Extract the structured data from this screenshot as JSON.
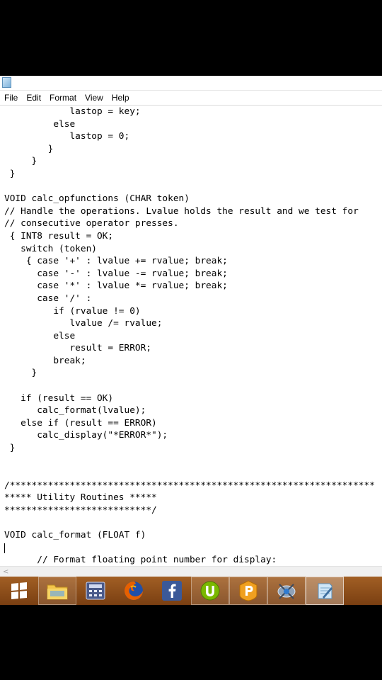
{
  "menubar": {
    "items": [
      "File",
      "Edit",
      "Format",
      "View",
      "Help"
    ]
  },
  "editor": {
    "lines": [
      "            lastop = key;",
      "         else",
      "            lastop = 0;",
      "        }",
      "     }",
      " }",
      "",
      "VOID calc_opfunctions (CHAR token)",
      "// Handle the operations. Lvalue holds the result and we test for",
      "// consecutive operator presses.",
      " { INT8 result = OK;",
      "   switch (token)",
      "    { case '+' : lvalue += rvalue; break;",
      "      case '-' : lvalue -= rvalue; break;",
      "      case '*' : lvalue *= rvalue; break;",
      "      case '/' :",
      "         if (rvalue != 0)",
      "            lvalue /= rvalue;",
      "         else",
      "            result = ERROR;",
      "         break;",
      "     }",
      "",
      "   if (result == OK)",
      "      calc_format(lvalue);",
      "   else if (result == ERROR)",
      "      calc_display(\"*ERROR*\");",
      " }",
      "",
      "",
      "/*******************************************************************",
      "***** Utility Routines *****",
      "***************************/",
      "",
      "VOID calc_format (FLOAT f)",
      "// Format floating point number for display:"
    ]
  },
  "scrollbar": {
    "left_arrow": "<"
  },
  "taskbar": {
    "items": [
      "start",
      "file-explorer",
      "calculator",
      "firefox",
      "facebook",
      "utorrent",
      "kingsoft-presentation",
      "network-tool",
      "notepad"
    ]
  },
  "colors": {
    "taskbar": "#8c4d1a",
    "firefox_orange": "#e66000",
    "facebook_blue": "#3b5998",
    "utorrent_green": "#7ab800",
    "presentation_orange": "#f0a020"
  }
}
